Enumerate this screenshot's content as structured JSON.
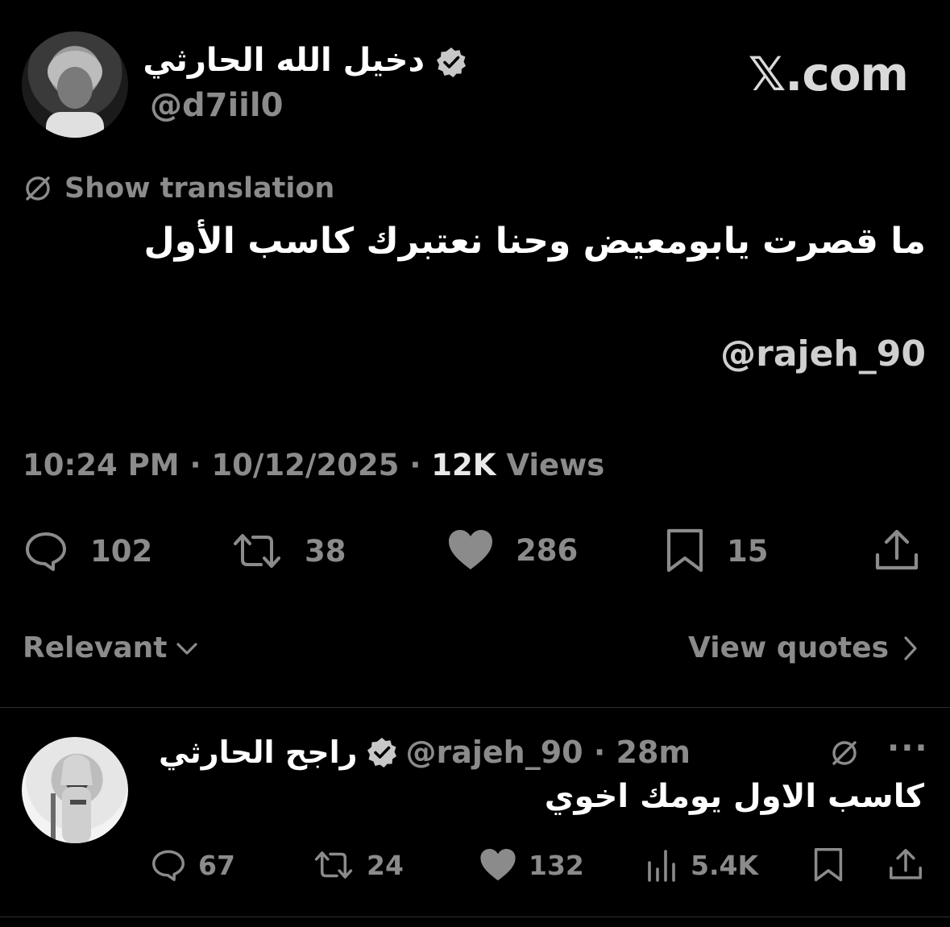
{
  "brand": "𝕏.com",
  "tweet": {
    "author_name": "دخيل الله الحارثي",
    "author_handle": "@d7iil0",
    "translate_label": "Show translation",
    "text": "ما قصرت يابومعيض وحنا نعتبرك كاسب الأول",
    "mention": "@rajeh_90",
    "time": "10:24 PM",
    "date": "10/12/2025",
    "views_count": "12K",
    "views_label": "Views",
    "separator": "·"
  },
  "actions": {
    "replies": "102",
    "retweets": "38",
    "likes": "286",
    "bookmarks": "15"
  },
  "sort": {
    "label": "Relevant",
    "view_quotes": "View quotes"
  },
  "reply": {
    "name": "راجح الحارثي",
    "handle_time": "@rajeh_90 · 28m",
    "more": "···",
    "text": "كاسب الاول يومك اخوي",
    "replies": "67",
    "retweets": "24",
    "likes": "132",
    "views": "5.4K"
  },
  "colors": {
    "background": "#000000",
    "text": "#ffffff",
    "secondary": "#8b8b8b",
    "divider": "#2f2f2f"
  },
  "icons": [
    "verified-badge-icon",
    "translate-icon",
    "reply-icon",
    "retweet-icon",
    "like-icon",
    "bookmark-icon",
    "share-icon",
    "chevron-down-icon",
    "chevron-right-icon",
    "views-icon",
    "more-icon"
  ]
}
